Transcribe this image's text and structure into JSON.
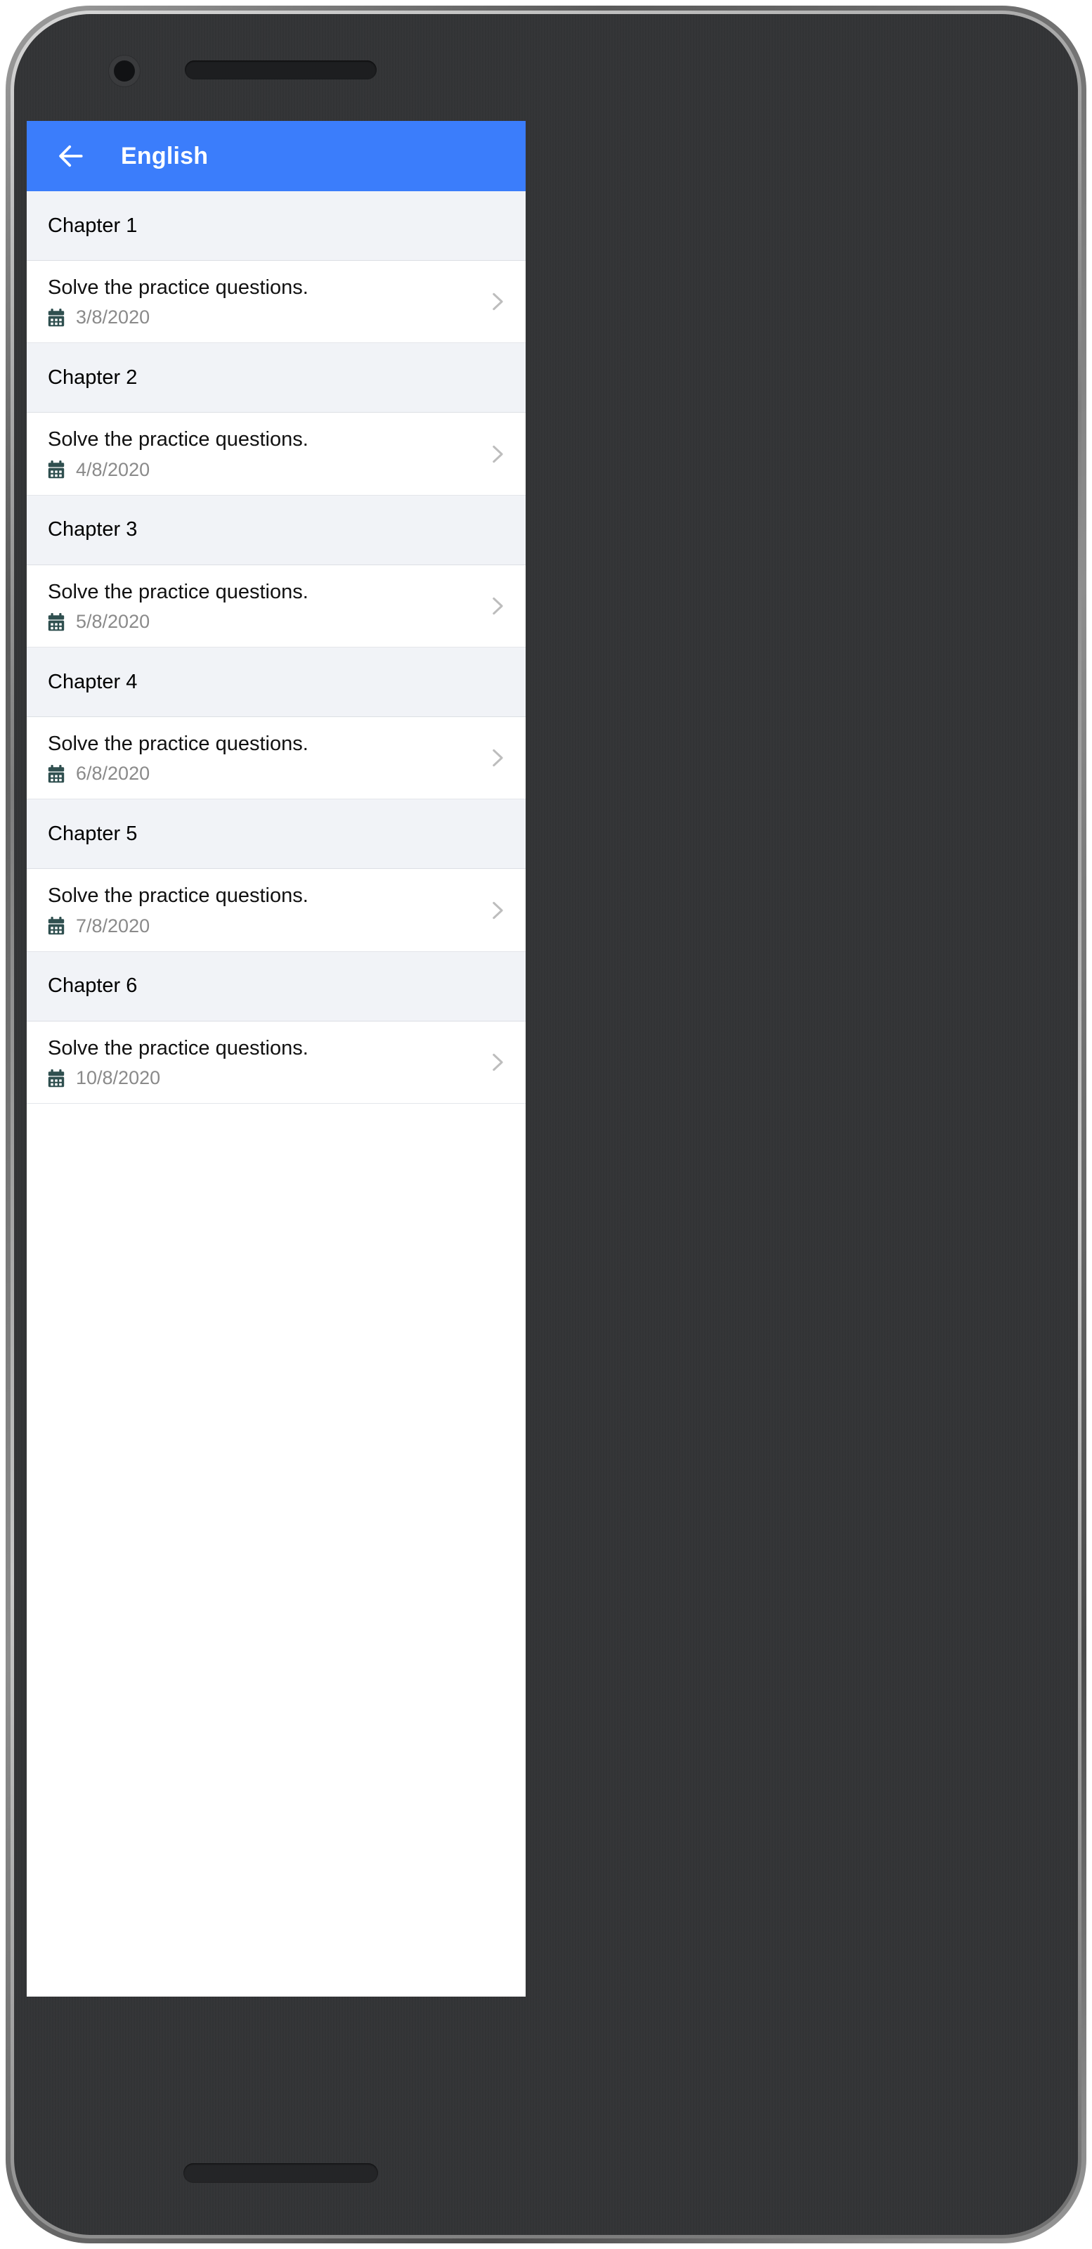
{
  "device": {
    "camera_icon": "front-camera",
    "speaker_icon": "earpiece-speaker",
    "home_indicator_icon": "home-indicator"
  },
  "theme": {
    "app_bar_color": "#3b7dfb",
    "section_header_bg": "#f1f3f7",
    "row_bg": "#ffffff",
    "title_text_color": "#111111",
    "date_text_color": "#8a8a8a",
    "calendar_icon_color": "#2f4f4f",
    "chevron_icon_color": "#bdbdbd",
    "divider_color": "#e4e6ea"
  },
  "app_bar": {
    "back_icon": "arrow-left-icon",
    "title": "English"
  },
  "list": {
    "sections": [
      {
        "header": "Chapter 1",
        "items": [
          {
            "title": "Solve the practice questions.",
            "date": "3/8/2020",
            "date_icon": "calendar-icon",
            "chevron": "chevron-right-icon"
          }
        ]
      },
      {
        "header": "Chapter 2",
        "items": [
          {
            "title": "Solve the practice questions.",
            "date": "4/8/2020",
            "date_icon": "calendar-icon",
            "chevron": "chevron-right-icon"
          }
        ]
      },
      {
        "header": "Chapter 3",
        "items": [
          {
            "title": "Solve the practice questions.",
            "date": "5/8/2020",
            "date_icon": "calendar-icon",
            "chevron": "chevron-right-icon"
          }
        ]
      },
      {
        "header": "Chapter 4",
        "items": [
          {
            "title": "Solve the practice questions.",
            "date": "6/8/2020",
            "date_icon": "calendar-icon",
            "chevron": "chevron-right-icon"
          }
        ]
      },
      {
        "header": "Chapter 5",
        "items": [
          {
            "title": "Solve the practice questions.",
            "date": "7/8/2020",
            "date_icon": "calendar-icon",
            "chevron": "chevron-right-icon"
          }
        ]
      },
      {
        "header": "Chapter 6",
        "items": [
          {
            "title": "Solve the practice questions.",
            "date": "10/8/2020",
            "date_icon": "calendar-icon",
            "chevron": "chevron-right-icon"
          }
        ]
      }
    ]
  }
}
